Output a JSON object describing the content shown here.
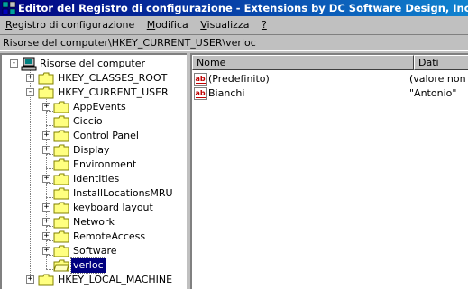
{
  "window": {
    "title": "Editor del Registro di configurazione - Extensions by DC Software Design, Inc. (Freeware)"
  },
  "menu": {
    "items": [
      {
        "accel": "R",
        "rest": "egistro di configurazione"
      },
      {
        "accel": "M",
        "rest": "odifica"
      },
      {
        "accel": "V",
        "rest": "isualizza"
      },
      {
        "accel": "?",
        "rest": ""
      }
    ]
  },
  "address": {
    "path": "Risorse del computer\\HKEY_CURRENT_USER\\verloc"
  },
  "tree": {
    "root": {
      "label": "Risorse del computer",
      "expander": "-",
      "icon": "computer-icon"
    },
    "hives": [
      {
        "label": "HKEY_CLASSES_ROOT",
        "expander": "+"
      },
      {
        "label": "HKEY_CURRENT_USER",
        "expander": "-"
      },
      {
        "label": "HKEY_LOCAL_MACHINE",
        "expander": "+"
      }
    ],
    "subkeys": [
      {
        "label": "AppEvents",
        "expander": "+"
      },
      {
        "label": "Ciccio",
        "expander": ""
      },
      {
        "label": "Control Panel",
        "expander": "+"
      },
      {
        "label": "Display",
        "expander": "+"
      },
      {
        "label": "Environment",
        "expander": ""
      },
      {
        "label": "Identities",
        "expander": "+"
      },
      {
        "label": "InstallLocationsMRU",
        "expander": ""
      },
      {
        "label": "keyboard layout",
        "expander": "+"
      },
      {
        "label": "Network",
        "expander": "+"
      },
      {
        "label": "RemoteAccess",
        "expander": "+"
      },
      {
        "label": "Software",
        "expander": "+"
      },
      {
        "label": "verloc",
        "expander": "",
        "selected": true
      }
    ]
  },
  "values": {
    "columns": [
      "Nome",
      "Dati"
    ],
    "rows": [
      {
        "name": "(Predefinito)",
        "data": "(valore non impostato)",
        "icon": "string-value-icon"
      },
      {
        "name": "Bianchi",
        "data": "\"Antonio\"",
        "icon": "string-value-icon"
      }
    ]
  },
  "colors": {
    "title_start": "#000080",
    "title_end": "#1084d0",
    "selection": "#000080",
    "face": "#c0c0c0"
  }
}
